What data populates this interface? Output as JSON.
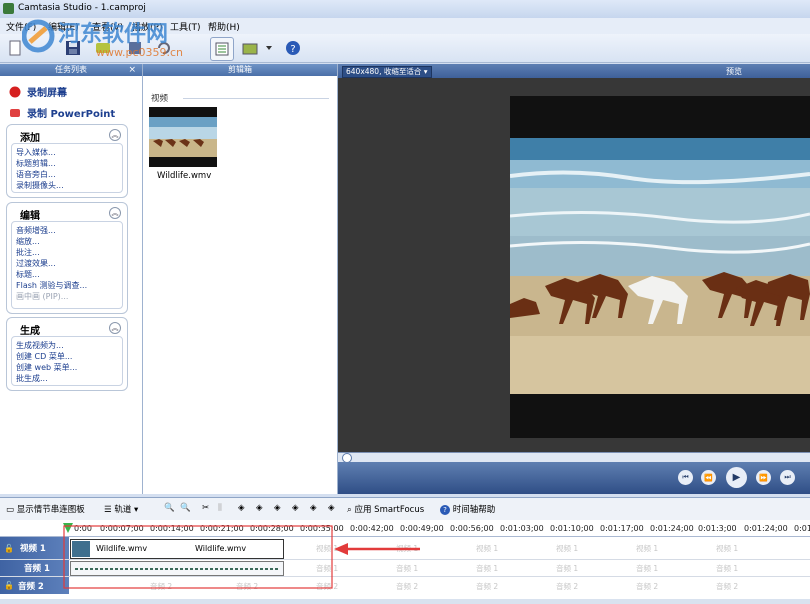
{
  "window": {
    "title": "Camtasia Studio - 1.camproj"
  },
  "watermark": {
    "text": "河东软件网",
    "url": "www.pc0359.cn"
  },
  "menu": {
    "file": "文件(F)",
    "edit": "编辑(E)",
    "view": "查看(V)",
    "play": "播放(P)",
    "tools": "工具(T)",
    "help": "帮助(H)"
  },
  "task_panel": {
    "title": "任务列表",
    "close": "×",
    "record_screen": "录制屏幕",
    "record_powerpoint": "录制 PowerPoint",
    "groups": [
      {
        "title": "添加",
        "items": [
          "导入媒体...",
          "标题剪辑...",
          "语音旁白...",
          "录制摄像头..."
        ],
        "disabled": []
      },
      {
        "title": "编辑",
        "items": [
          "音频增强...",
          "缩放...",
          "批注...",
          "过渡效果...",
          "标题...",
          "Flash 测验与调查...",
          "画中画 (PIP)..."
        ],
        "disabled": [
          6
        ]
      },
      {
        "title": "生成",
        "items": [
          "生成视频为...",
          "创建 CD 菜单...",
          "创建 web 菜单...",
          "批生成..."
        ],
        "disabled": []
      }
    ]
  },
  "clip_bin": {
    "title": "剪辑箱",
    "section": "视频",
    "clip_name": "Wildlife.wmv"
  },
  "preview": {
    "title": "预览",
    "zoom": "640x480, 收缩至适合"
  },
  "timeline_toolbar": {
    "storyboard": "显示情节串连图板",
    "tracks": "轨道",
    "smartfocus": "应用 SmartFocus",
    "help": "时间轴帮助"
  },
  "ruler": {
    "ticks": [
      "0:00",
      "0:00:07;00",
      "0:00:14;00",
      "0:00:21;00",
      "0:00:28;00",
      "0:00:35;00",
      "0:00:42;00",
      "0:00:49;00",
      "0:00:56;00",
      "0:01:03;00",
      "0:01:10;00",
      "0:01:17;00",
      "0:01:24;00",
      "0:01:3;00",
      "0:01:24;00",
      "0:01:"
    ]
  },
  "tracks": {
    "video1": "视频 1",
    "audio1": "音频 1",
    "audio2": "音频 2",
    "clip1": "Wildlife.wmv",
    "clip2": "Wildlife.wmv",
    "ghost_video": "视频 1",
    "ghost_audio1": "音频 1",
    "ghost_audio2": "音频 2"
  },
  "colors": {
    "accent": "#3e609a",
    "annotation": "#e23b3b"
  }
}
